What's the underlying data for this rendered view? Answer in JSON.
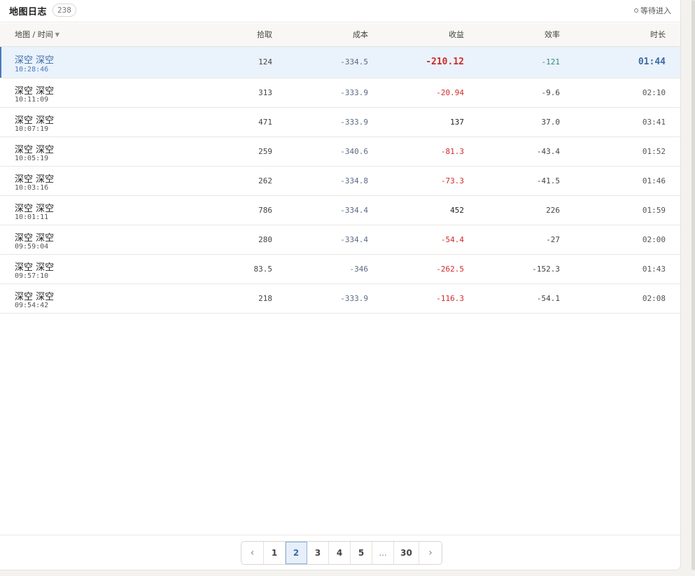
{
  "header": {
    "title": "地图日志",
    "count": "238",
    "status": "等待进入"
  },
  "columns": {
    "map_time": "地图 / 时间",
    "pick": "拾取",
    "cost": "成本",
    "profit": "收益",
    "efficiency": "效率",
    "duration": "时长"
  },
  "rows": [
    {
      "map": "深空 深空",
      "time": "10:28:46",
      "pick": "124",
      "cost": "-334.5",
      "profit": "-210.12",
      "efficiency": "-121",
      "duration": "01:44"
    },
    {
      "map": "深空 深空",
      "time": "10:11:09",
      "pick": "313",
      "cost": "-333.9",
      "profit": "-20.94",
      "efficiency": "-9.6",
      "duration": "02:10"
    },
    {
      "map": "深空 深空",
      "time": "10:07:19",
      "pick": "471",
      "cost": "-333.9",
      "profit": "137",
      "efficiency": "37.0",
      "duration": "03:41"
    },
    {
      "map": "深空 深空",
      "time": "10:05:19",
      "pick": "259",
      "cost": "-340.6",
      "profit": "-81.3",
      "efficiency": "-43.4",
      "duration": "01:52"
    },
    {
      "map": "深空 深空",
      "time": "10:03:16",
      "pick": "262",
      "cost": "-334.8",
      "profit": "-73.3",
      "efficiency": "-41.5",
      "duration": "01:46"
    },
    {
      "map": "深空 深空",
      "time": "10:01:11",
      "pick": "786",
      "cost": "-334.4",
      "profit": "452",
      "efficiency": "226",
      "duration": "01:59"
    },
    {
      "map": "深空 深空",
      "time": "09:59:04",
      "pick": "280",
      "cost": "-334.4",
      "profit": "-54.4",
      "efficiency": "-27",
      "duration": "02:00"
    },
    {
      "map": "深空 深空",
      "time": "09:57:10",
      "pick": "83.5",
      "cost": "-346",
      "profit": "-262.5",
      "efficiency": "-152.3",
      "duration": "01:43"
    },
    {
      "map": "深空 深空",
      "time": "09:54:42",
      "pick": "218",
      "cost": "-333.9",
      "profit": "-116.3",
      "efficiency": "-54.1",
      "duration": "02:08"
    }
  ],
  "pagination": {
    "prev": "‹",
    "next": "›",
    "pages": [
      "1",
      "2",
      "3",
      "4",
      "5",
      "...",
      "30"
    ],
    "current": "2"
  },
  "colors": {
    "accent": "#3d6ba3",
    "negative": "#d02a2a",
    "efficiency_active": "#2e8a7e"
  }
}
